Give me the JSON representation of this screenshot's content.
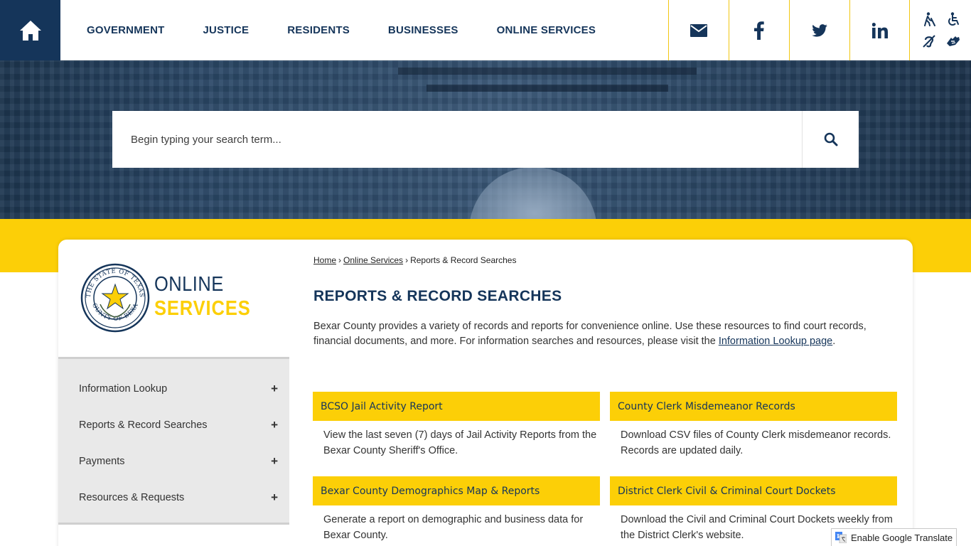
{
  "header": {
    "nav": [
      "GOVERNMENT",
      "JUSTICE",
      "RESIDENTS",
      "BUSINESSES",
      "ONLINE SERVICES"
    ]
  },
  "search": {
    "placeholder": "Begin typing your search term..."
  },
  "logo": {
    "top": "ONLINE",
    "bottom": "SERVICES",
    "seal_text": [
      "THE STATE OF TEXAS",
      "COUNTY OF BEXAR"
    ]
  },
  "sidenav": {
    "items": [
      {
        "label": "Information Lookup",
        "toggle": "+"
      },
      {
        "label": "Reports & Record Searches",
        "toggle": "+"
      },
      {
        "label": "Payments",
        "toggle": "+"
      },
      {
        "label": "Resources & Requests",
        "toggle": "+"
      }
    ]
  },
  "breadcrumb": {
    "home": "Home",
    "sep": "›",
    "parent": "Online Services",
    "current": "Reports & Record Searches"
  },
  "page": {
    "title": "REPORTS & RECORD SEARCHES",
    "intro": "Bexar County provides a variety of records and reports for convenience online. Use these resources to find court records, financial documents, and more. For information searches and resources, please visit the ",
    "intro_link": "Information Lookup page",
    "intro_end": "."
  },
  "tiles": [
    {
      "title": "BCSO Jail Activity Report",
      "body": "View the last seven (7) days of Jail Activity Reports from the Bexar County Sheriff's Office."
    },
    {
      "title": "County Clerk Misdemeanor Records",
      "body": "Download CSV files of County Clerk misdemeanor records. Records are updated daily."
    },
    {
      "title": "Bexar County Demographics Map & Reports",
      "body": "Generate a report on demographic and business data for Bexar County."
    },
    {
      "title": "District Clerk Civil & Criminal Court Dockets",
      "body": "Download the Civil and Criminal Court Dockets weekly from the District Clerk's website."
    }
  ],
  "translate": {
    "label": "Enable Google Translate"
  },
  "colors": {
    "navy": "#15355a",
    "yellow": "#fccf07"
  }
}
